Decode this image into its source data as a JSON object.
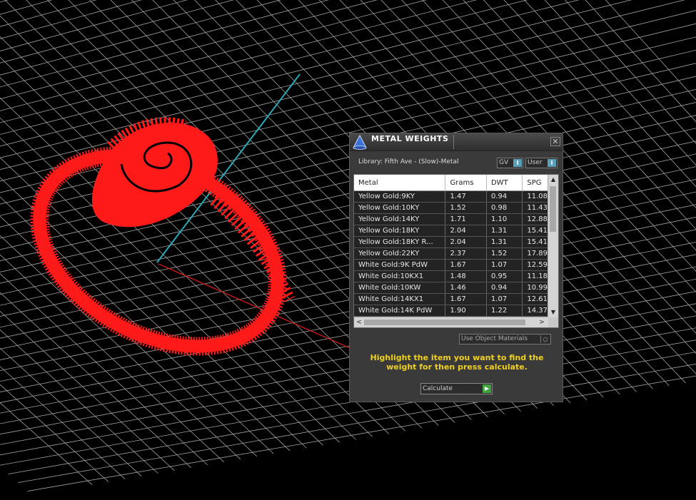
{
  "panel": {
    "title": "METAL WEIGHTS",
    "close_label": "✕",
    "library": "Library: Fifth Ave - (Slow)-Metal",
    "gv_toggle": "GV",
    "user_toggle": "User",
    "use_object_materials": "Use Object Materials",
    "hint": "Highlight the item you want to find the weight for then press calculate.",
    "calculate": "Calculate"
  },
  "table": {
    "columns": [
      "Metal",
      "Grams",
      "DWT",
      "SPG"
    ],
    "rows": [
      [
        "Yellow Gold:9KY",
        "1.47",
        "0.94",
        "11.08"
      ],
      [
        "Yellow Gold:10KY",
        "1.52",
        "0.98",
        "11.43"
      ],
      [
        "Yellow Gold:14KY",
        "1.71",
        "1.10",
        "12.88"
      ],
      [
        "Yellow Gold:18KY",
        "2.04",
        "1.31",
        "15.41"
      ],
      [
        "Yellow Gold:18KY R...",
        "2.04",
        "1.31",
        "15.41"
      ],
      [
        "Yellow Gold:22KY",
        "2.37",
        "1.52",
        "17.89"
      ],
      [
        "White Gold:9K PdW",
        "1.67",
        "1.07",
        "12.59"
      ],
      [
        "White Gold:10KX1",
        "1.48",
        "0.95",
        "11.18"
      ],
      [
        "White Gold:10KW",
        "1.46",
        "0.94",
        "10.99"
      ],
      [
        "White Gold:14KX1",
        "1.67",
        "1.07",
        "12.61"
      ],
      [
        "White Gold:14K PdW",
        "1.90",
        "1.22",
        "14.37"
      ]
    ]
  },
  "colors": {
    "model": "#ff1a1a",
    "grid": "#bfbfbf",
    "axis_y": "#2aa8b8",
    "axis_x": "#c01818",
    "hint": "#f0d020"
  }
}
